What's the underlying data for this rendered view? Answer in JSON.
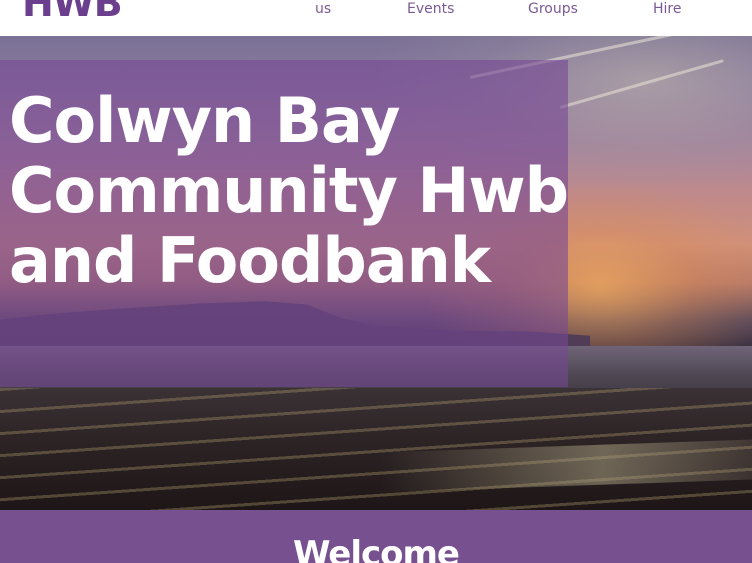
{
  "header": {
    "logo_text": "HWB",
    "nav": [
      {
        "label": "us"
      },
      {
        "label": "Events"
      },
      {
        "label": "Groups"
      },
      {
        "label": "Hire"
      }
    ]
  },
  "hero": {
    "title": "Colwyn Bay Community Hwb and Foodbank",
    "overlay_color": "#764894"
  },
  "welcome": {
    "heading": "Welcome",
    "band_color": "#77508f"
  },
  "colors": {
    "brand_purple": "#6b3f8e",
    "nav_text": "#7b5a94"
  }
}
